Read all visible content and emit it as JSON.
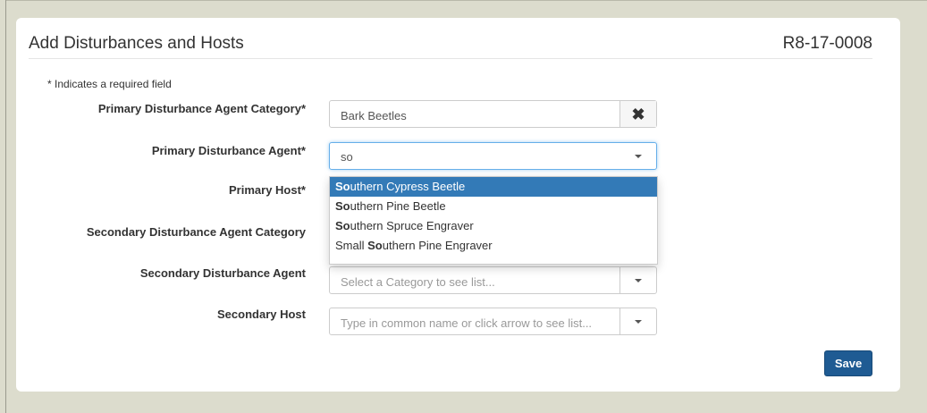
{
  "header": {
    "title": "Add Disturbances and Hosts",
    "record_id": "R8-17-0008"
  },
  "required_note": "* Indicates a required field",
  "fields": {
    "primary_category": {
      "label": "Primary Disturbance Agent Category*",
      "value": "Bark Beetles",
      "clear_icon": "close-icon"
    },
    "primary_agent": {
      "label": "Primary Disturbance Agent*",
      "value": "so",
      "icon": "chevron-down-icon"
    },
    "primary_host": {
      "label": "Primary Host*"
    },
    "secondary_category": {
      "label": "Secondary Disturbance Agent Category"
    },
    "secondary_agent": {
      "label": "Secondary Disturbance Agent",
      "placeholder": "Select a Category to see list...",
      "icon": "chevron-down-icon"
    },
    "secondary_host": {
      "label": "Secondary Host",
      "placeholder": "Type in common name or click arrow to see list...",
      "icon": "chevron-down-icon"
    }
  },
  "suggestions": [
    {
      "match": "So",
      "rest": "uthern Cypress Beetle",
      "prefix": ""
    },
    {
      "match": "So",
      "rest": "uthern Pine Beetle",
      "prefix": ""
    },
    {
      "match": "So",
      "rest": "uthern Spruce Engraver",
      "prefix": ""
    },
    {
      "match": "So",
      "rest": "uthern Pine Engraver",
      "prefix": "Small "
    }
  ],
  "actions": {
    "save_label": "Save"
  },
  "colors": {
    "primary": "#1f5b93",
    "highlight": "#337ab7",
    "background": "#dcdccd"
  }
}
